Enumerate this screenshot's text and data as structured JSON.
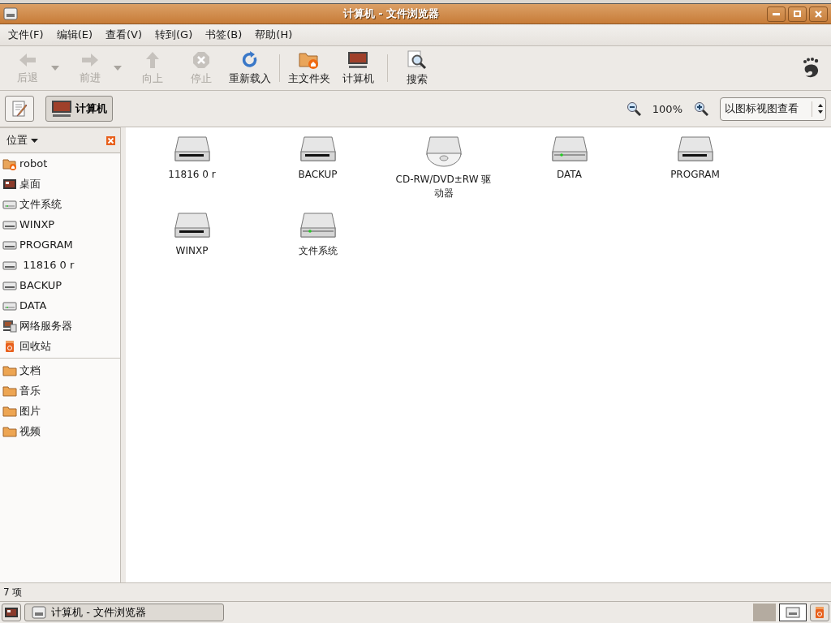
{
  "window": {
    "title": "计算机 - 文件浏览器"
  },
  "menu": [
    "文件(F)",
    "编辑(E)",
    "查看(V)",
    "转到(G)",
    "书签(B)",
    "帮助(H)"
  ],
  "toolbar": [
    {
      "kind": "back",
      "label": "后退",
      "disabled": true,
      "dropdown": true
    },
    {
      "kind": "forward",
      "label": "前进",
      "disabled": true,
      "dropdown": true
    },
    {
      "kind": "up",
      "label": "向上",
      "disabled": true,
      "dropdown": false
    },
    {
      "kind": "stop",
      "label": "停止",
      "disabled": true,
      "dropdown": false
    },
    {
      "kind": "reload",
      "label": "重新载入",
      "disabled": false,
      "dropdown": false
    },
    {
      "kind": "separator"
    },
    {
      "kind": "home",
      "label": "主文件夹",
      "disabled": false,
      "dropdown": false
    },
    {
      "kind": "computer",
      "label": "计算机",
      "disabled": false,
      "dropdown": false
    },
    {
      "kind": "separator"
    },
    {
      "kind": "search",
      "label": "搜索",
      "disabled": false,
      "dropdown": false
    }
  ],
  "location": {
    "path_button": "计算机",
    "zoom": "100%",
    "view_mode": "以图标视图查看"
  },
  "sidebar": {
    "title": "位置",
    "groups": [
      [
        {
          "kind": "home",
          "label": "robot"
        },
        {
          "kind": "desktop",
          "label": "桌面"
        },
        {
          "kind": "drive-led",
          "label": "文件系统"
        },
        {
          "kind": "drive",
          "label": "WINXP"
        },
        {
          "kind": "drive",
          "label": "PROGRAM"
        },
        {
          "kind": "drive",
          "label": " 11816 0 r"
        },
        {
          "kind": "drive",
          "label": "BACKUP"
        },
        {
          "kind": "drive-led",
          "label": "DATA"
        },
        {
          "kind": "network",
          "label": "网络服务器"
        },
        {
          "kind": "trash",
          "label": "回收站"
        }
      ],
      [
        {
          "kind": "folder",
          "label": "文档"
        },
        {
          "kind": "folder",
          "label": "音乐"
        },
        {
          "kind": "folder",
          "label": "图片"
        },
        {
          "kind": "folder",
          "label": "视频"
        }
      ]
    ]
  },
  "files": [
    {
      "kind": "drive",
      "name": "11816 0 r"
    },
    {
      "kind": "drive",
      "name": "BACKUP"
    },
    {
      "kind": "optical",
      "name": "CD-RW/DVD±RW 驱动器"
    },
    {
      "kind": "drive-led",
      "name": "DATA"
    },
    {
      "kind": "drive",
      "name": "PROGRAM"
    },
    {
      "kind": "drive",
      "name": "WINXP"
    },
    {
      "kind": "drive-led",
      "name": "文件系统"
    }
  ],
  "status_bar": "7 项",
  "taskbar": {
    "tasks": [
      {
        "label": "计算机 - 文件浏览器",
        "selected": false
      }
    ]
  }
}
